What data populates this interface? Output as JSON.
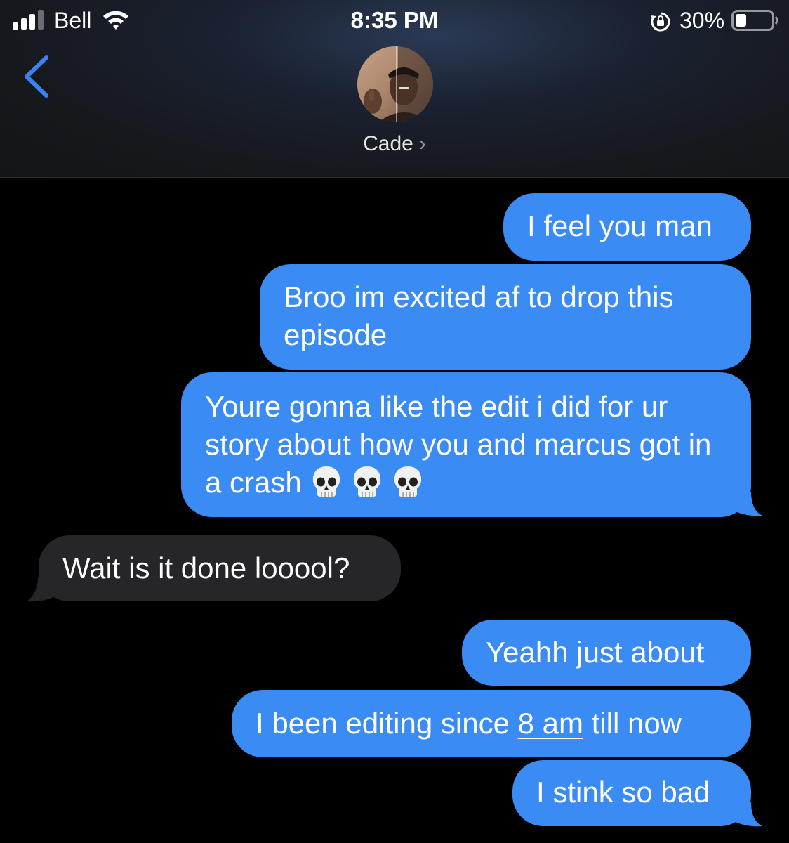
{
  "status_bar": {
    "carrier": "Bell",
    "time": "8:35 PM",
    "battery_percent": "30%",
    "battery_level": 0.3,
    "signal_bars": 3
  },
  "header": {
    "contact_name": "Cade",
    "chevron": "›"
  },
  "colors": {
    "sent_bubble": "#3b8bf5",
    "received_bubble": "#262628",
    "accent": "#3b82f6",
    "background": "#000000"
  },
  "messages": [
    {
      "direction": "sent",
      "text": "I feel you man"
    },
    {
      "direction": "sent",
      "text": "Broo im excited af to drop this episode"
    },
    {
      "direction": "sent",
      "text": "Youre gonna like the edit i did for ur story about how you and marcus got in a crash",
      "emoji": "skull-icon ×3"
    },
    {
      "direction": "received",
      "text": "Wait is it done looool?"
    },
    {
      "direction": "sent",
      "text": "Yeahh just about"
    },
    {
      "direction": "sent",
      "text_before": "I been editing since ",
      "link": "8 am",
      "text_after": " till now"
    },
    {
      "direction": "sent",
      "text": "I stink so bad"
    }
  ]
}
